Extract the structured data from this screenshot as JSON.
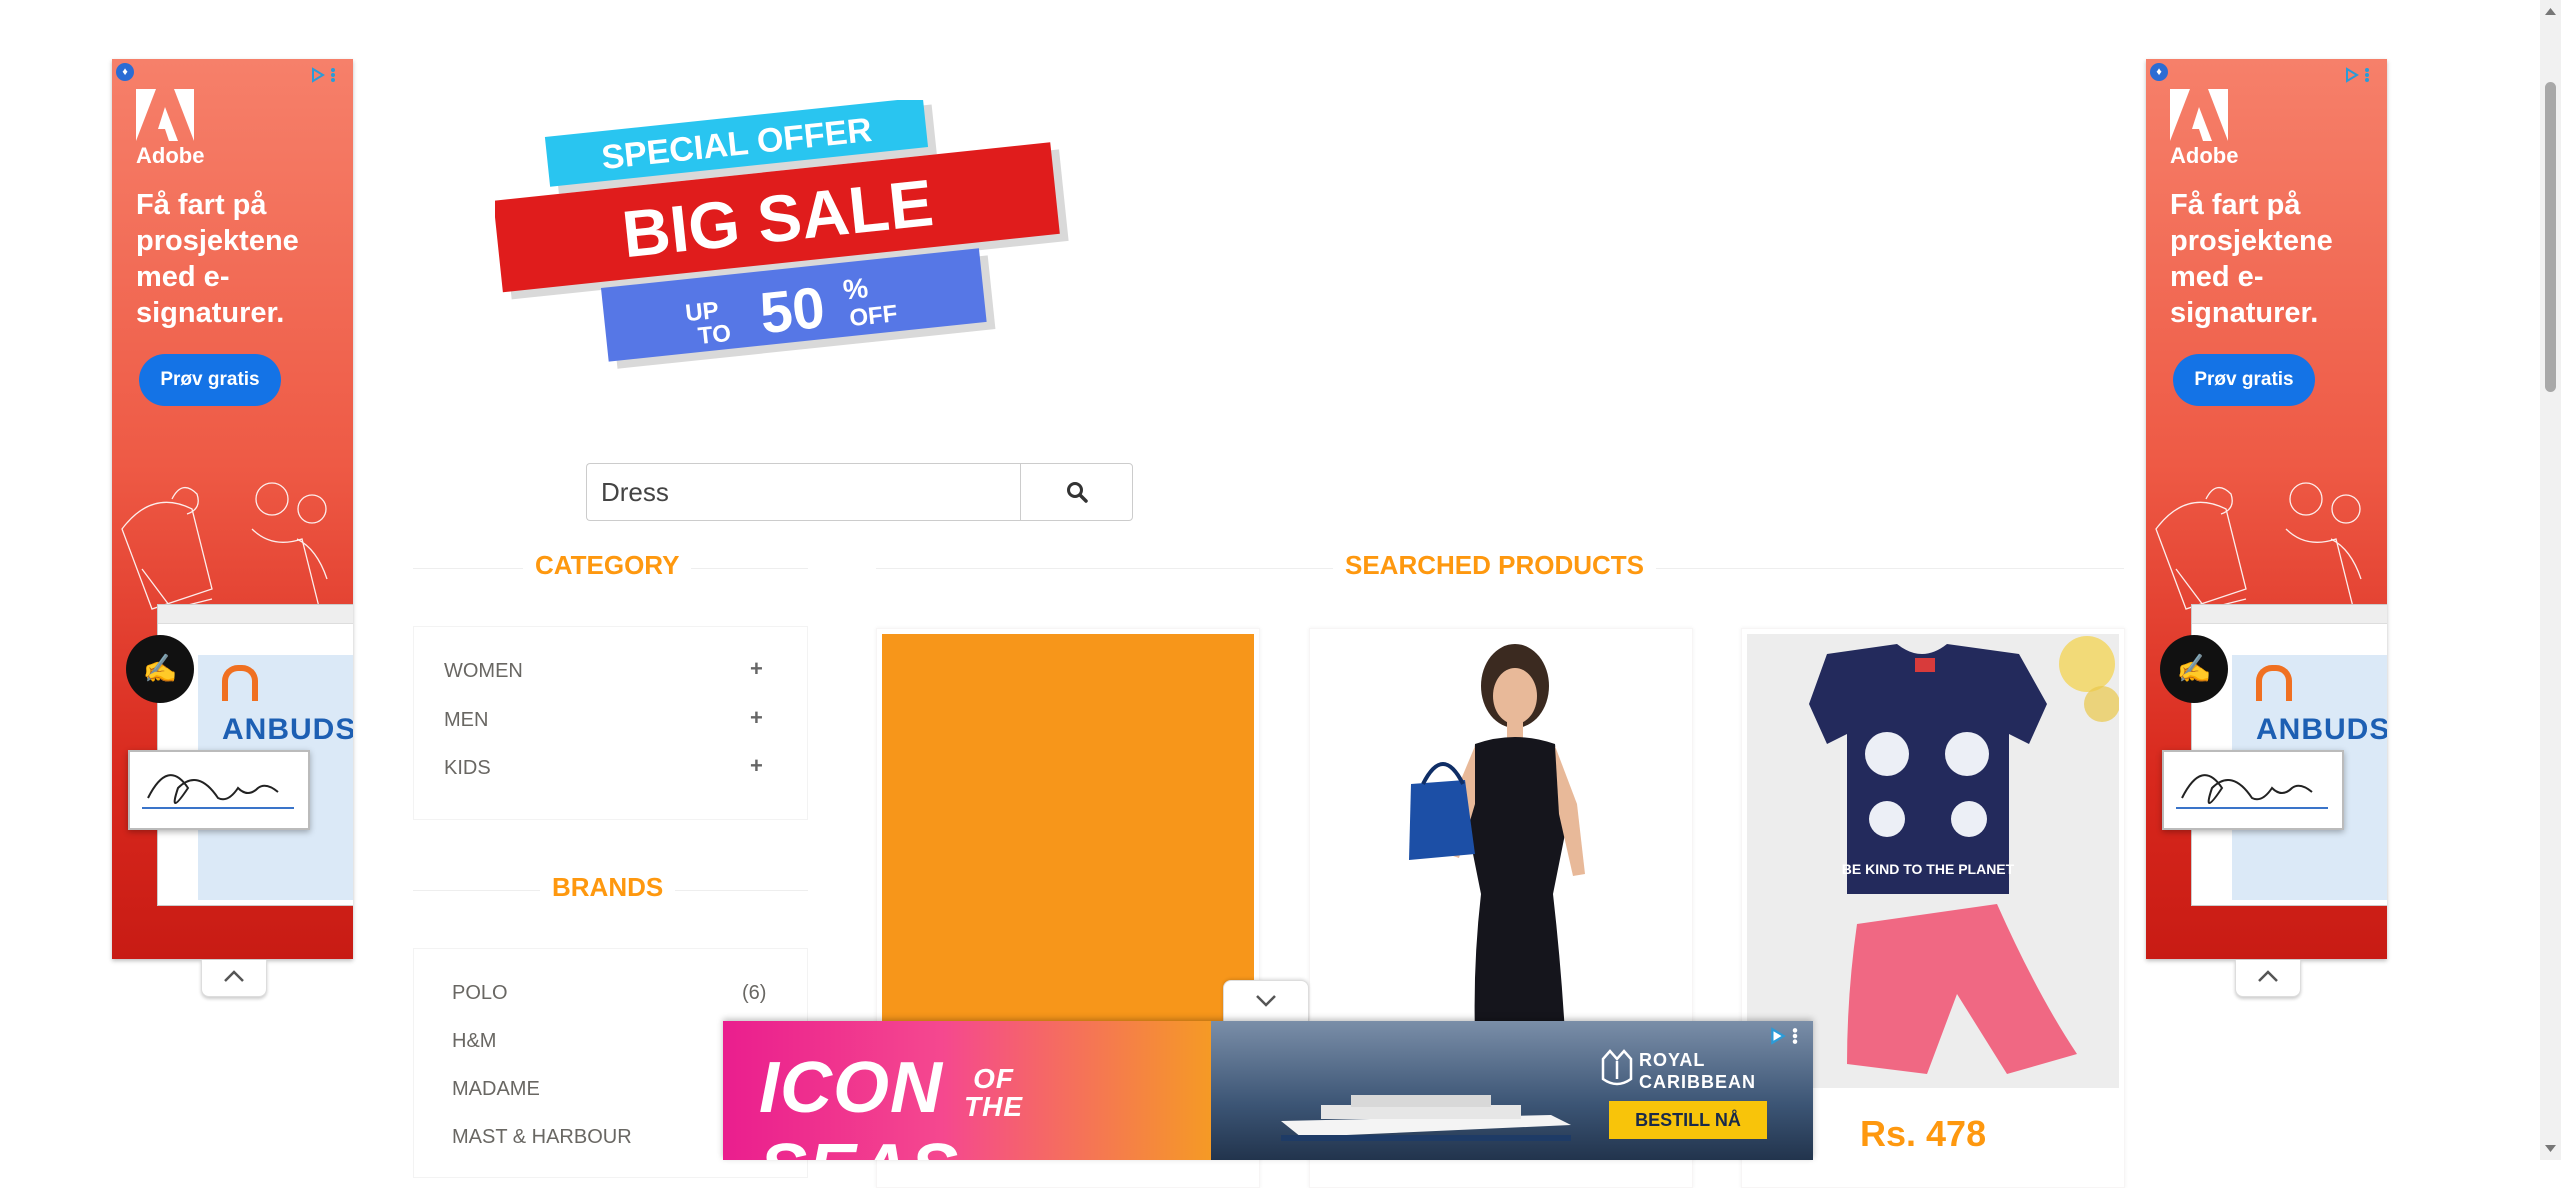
{
  "side_ad": {
    "brand": "Adobe",
    "headline": "Få fart på prosjektene med e-signaturer.",
    "cta": "Prøv gratis",
    "doc_heading": "ANBUDS",
    "signature": "BMac"
  },
  "banner": {
    "line1": "SPECIAL OFFER",
    "line2": "BIG SALE",
    "line3_up": "UP",
    "line3_to": "TO",
    "line3_num": "50",
    "line3_pct": "%",
    "line3_off": "OFF"
  },
  "search": {
    "value": "Dress"
  },
  "category": {
    "title": "CATEGORY",
    "items": [
      {
        "label": "WOMEN"
      },
      {
        "label": "MEN"
      },
      {
        "label": "KIDS"
      }
    ]
  },
  "brands": {
    "title": "BRANDS",
    "items": [
      {
        "label": "POLO",
        "count": "(6)"
      },
      {
        "label": "H&M",
        "count": ""
      },
      {
        "label": "MADAME",
        "count": ""
      },
      {
        "label": "MAST & HARBOUR",
        "count": ""
      }
    ]
  },
  "products": {
    "title": "SEARCHED PRODUCTS",
    "items": [
      {
        "price": ""
      },
      {
        "price": ""
      },
      {
        "price": "Rs. 478"
      }
    ],
    "tshirt_text": "BE KIND TO THE PLANET"
  },
  "bottom_ad": {
    "title_icon": "ICON",
    "title_of": "OF",
    "title_the": "THE",
    "title_seas": "SEAS",
    "brand_line1": "ROYAL",
    "brand_line2": "CARIBBEAN",
    "cta": "BESTILL NÅ"
  },
  "colors": {
    "accent": "#fe980f",
    "ad_red": "#d8281d",
    "ad_button": "#1473e6"
  }
}
